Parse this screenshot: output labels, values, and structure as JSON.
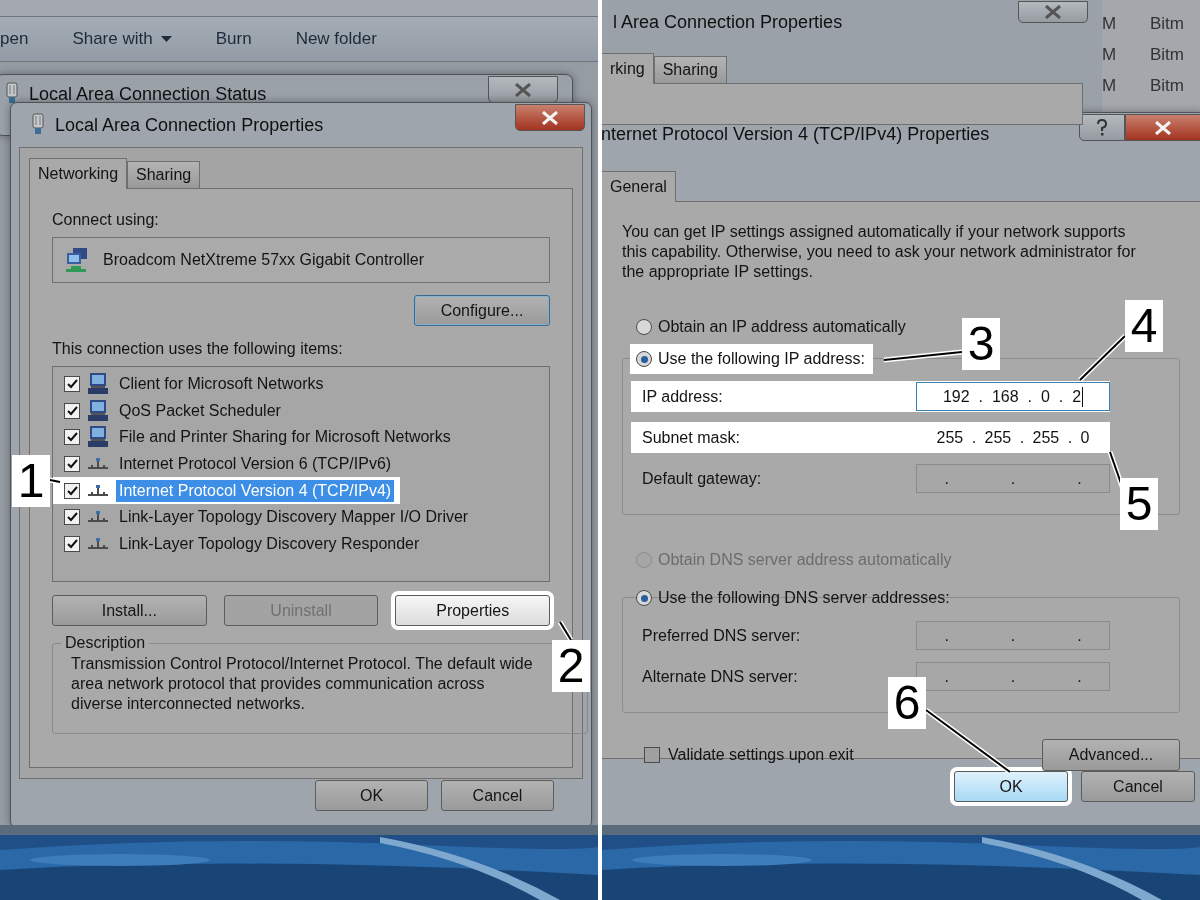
{
  "left_screenshot": {
    "explorer_toolbar": [
      {
        "label": "pen",
        "has_menu": false
      },
      {
        "label": "Share with",
        "has_menu": true
      },
      {
        "label": "Burn",
        "has_menu": false
      },
      {
        "label": "New folder",
        "has_menu": false
      }
    ],
    "status_window": {
      "title": "Local Area Connection Status"
    },
    "properties_dialog": {
      "title": "Local Area Connection Properties",
      "tabs": [
        {
          "label": "Networking",
          "selected": true
        },
        {
          "label": "Sharing",
          "selected": false
        }
      ],
      "connect_using_label": "Connect using:",
      "adapter": "Broadcom NetXtreme 57xx Gigabit Controller",
      "configure_button": {
        "label": "Configure...",
        "focused": true
      },
      "items_label": "This connection uses the following items:",
      "items": [
        {
          "label": "Client for Microsoft Networks",
          "kind": "client",
          "checked": true,
          "selected": false
        },
        {
          "label": "QoS Packet Scheduler",
          "kind": "service",
          "checked": true,
          "selected": false
        },
        {
          "label": "File and Printer Sharing for Microsoft Networks",
          "kind": "service",
          "checked": true,
          "selected": false
        },
        {
          "label": "Internet Protocol Version 6 (TCP/IPv6)",
          "kind": "protocol",
          "checked": true,
          "selected": false
        },
        {
          "label": "Internet Protocol Version 4 (TCP/IPv4)",
          "kind": "protocol",
          "checked": true,
          "selected": true
        },
        {
          "label": "Link-Layer Topology Discovery Mapper I/O Driver",
          "kind": "protocol",
          "checked": true,
          "selected": false
        },
        {
          "label": "Link-Layer Topology Discovery Responder",
          "kind": "protocol",
          "checked": true,
          "selected": false
        }
      ],
      "item_buttons": [
        {
          "label": "Install...",
          "disabled": false,
          "highlighted": false
        },
        {
          "label": "Uninstall",
          "disabled": true,
          "highlighted": false
        },
        {
          "label": "Properties",
          "disabled": false,
          "highlighted": true
        }
      ],
      "description": {
        "title": "Description",
        "text": "Transmission Control Protocol/Internet Protocol. The default wide area network protocol that provides communication across diverse interconnected networks."
      },
      "footer_buttons": [
        "OK",
        "Cancel"
      ]
    }
  },
  "right_screenshot": {
    "background_window": {
      "title": "l Area Connection Properties",
      "tabs": [
        {
          "label": "rking",
          "selected": true
        },
        {
          "label": "Sharing",
          "selected": false
        }
      ]
    },
    "file_list_rows": [
      {
        "column_1": "M",
        "column_2": "Bitm"
      },
      {
        "column_1": "M",
        "column_2": "Bitm"
      },
      {
        "column_1": "M",
        "column_2": "Bitm"
      }
    ],
    "ipv4_dialog": {
      "title": "nternet Protocol Version 4 (TCP/IPv4) Properties",
      "tabs": [
        {
          "label": "General",
          "selected": true
        }
      ],
      "intro": "You can get IP settings assigned automatically if your network supports this capability. Otherwise, you need to ask your network administrator for the appropriate IP settings.",
      "ip_options": [
        {
          "label": "Obtain an IP address automatically",
          "selected": false,
          "disabled": false,
          "highlighted": false
        },
        {
          "label": "Use the following IP address:",
          "selected": true,
          "disabled": false,
          "highlighted": true
        }
      ],
      "ip_fields": [
        {
          "label": "IP address:",
          "value": "192 . 168 . 0 . 2",
          "highlighted": true,
          "focused": true
        },
        {
          "label": "Subnet mask:",
          "value": "255 . 255 . 255 . 0",
          "highlighted": true,
          "focused": false
        },
        {
          "label": "Default gateway:",
          "value": ". . .",
          "highlighted": false,
          "focused": false
        }
      ],
      "dns_options": [
        {
          "label": "Obtain DNS server address automatically",
          "selected": false,
          "disabled": true,
          "highlighted": false
        },
        {
          "label": "Use the following DNS server addresses:",
          "selected": true,
          "disabled": false,
          "highlighted": false
        }
      ],
      "dns_fields": [
        {
          "label": "Preferred DNS server:",
          "value": ". . .",
          "highlighted": false,
          "focused": false
        },
        {
          "label": "Alternate DNS server:",
          "value": ". . .",
          "highlighted": false,
          "focused": false
        }
      ],
      "validate_checkbox": {
        "label": "Validate settings upon exit",
        "checked": false
      },
      "advanced_button": "Advanced...",
      "footer_buttons": [
        {
          "label": "OK",
          "highlighted": true
        },
        {
          "label": "Cancel",
          "highlighted": false
        }
      ]
    }
  },
  "callouts": [
    "1",
    "2",
    "3",
    "4",
    "5",
    "6"
  ]
}
